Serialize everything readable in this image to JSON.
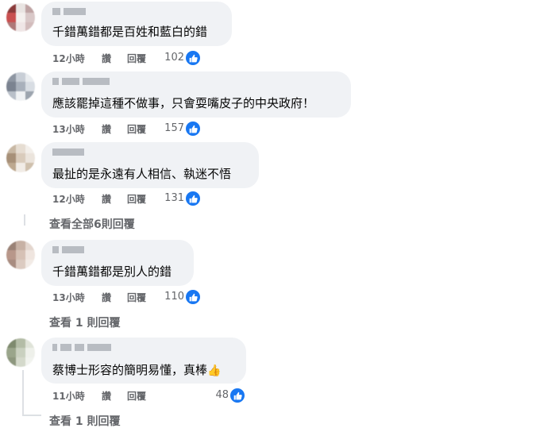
{
  "comments": [
    {
      "text": "千錯萬錯都是百姓和藍白的錯",
      "time": "12小時",
      "like": "讚",
      "reply": "回覆",
      "likes": "102",
      "avatar_colors": [
        "#8a3a3a",
        "#e9e4e2",
        "#bfa3a3",
        "#c95050",
        "#f4f0ee",
        "#d9c8c8",
        "#ae7878",
        "#efe6e6",
        "#d2bcbc"
      ]
    },
    {
      "text": "應該罷掉這種不做事，只會耍嘴皮子的中央政府！",
      "time": "13小時",
      "like": "讚",
      "reply": "回覆",
      "likes": "157",
      "avatar_colors": [
        "#8e96a2",
        "#c8ced6",
        "#e9ecef",
        "#7b8390",
        "#a8b0bb",
        "#d8dde3",
        "#b9c0c9",
        "#f0f2f4",
        "#9ca4ae"
      ]
    },
    {
      "text": "最扯的是永遠有人相信、執迷不悟",
      "time": "12小時",
      "like": "讚",
      "reply": "回覆",
      "likes": "131",
      "avatar_colors": [
        "#c8b8a4",
        "#e6ddd2",
        "#f3efea",
        "#a79078",
        "#d9cbbb",
        "#ebe4dc",
        "#bda88f",
        "#f1ece6",
        "#cfc0ad"
      ]
    },
    {
      "text": "千錯萬錯都是別人的錯",
      "time": "13小時",
      "like": "讚",
      "reply": "回覆",
      "likes": "110",
      "avatar_colors": [
        "#9a8276",
        "#c7b1a4",
        "#e3d6ce",
        "#b8978a",
        "#d6c1b5",
        "#efe5df",
        "#a88c80",
        "#dccbc1",
        "#f2ebe6"
      ]
    },
    {
      "text": "蔡博士形容的簡明易懂，真棒",
      "emoji": "👍",
      "time": "11小時",
      "like": "讚",
      "reply": "回覆",
      "likes": "48",
      "avatar_colors": [
        "#7e8a6e",
        "#b3bca6",
        "#dfe3d8",
        "#9aa58b",
        "#c9d0bf",
        "#eef0ea",
        "#8d977e",
        "#d4d9cb",
        "#f1f3ee"
      ]
    }
  ],
  "view_replies": [
    "查看全部6則回覆",
    "查看 1 則回覆",
    "查看 1 則回覆"
  ],
  "colors": {
    "accent": "#1877f2",
    "meta": "#65676b",
    "bubble": "#f0f2f5"
  }
}
